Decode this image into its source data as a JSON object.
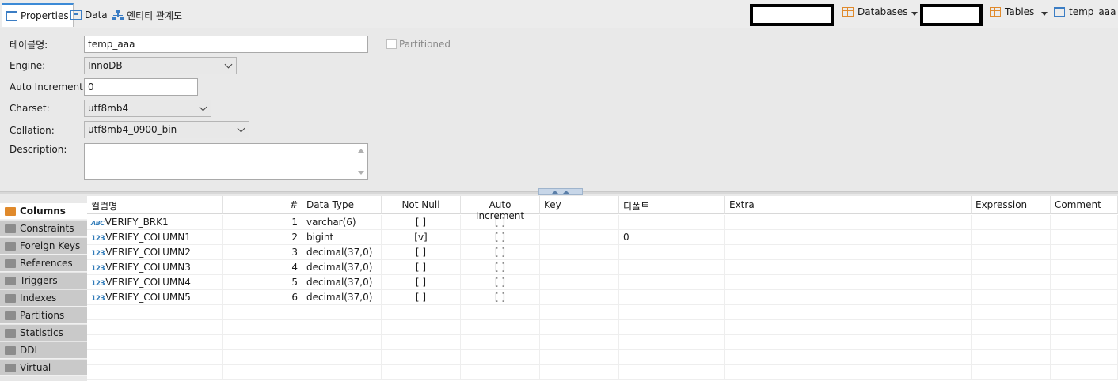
{
  "tabs": [
    {
      "label": "Properties",
      "icon": "properties-icon"
    },
    {
      "label": "Data",
      "icon": "data-grid-icon"
    },
    {
      "label": "엔티티 관계도",
      "icon": "er-diagram-icon"
    }
  ],
  "breadcrumb": {
    "databases": "Databases",
    "tables": "Tables",
    "table": "temp_aaa"
  },
  "properties": {
    "table_name_label": "테이블명:",
    "table_name": "temp_aaa",
    "partitioned_label": "Partitioned",
    "engine_label": "Engine:",
    "engine": "InnoDB",
    "auto_increment_label": "Auto Increment:",
    "auto_increment": "0",
    "charset_label": "Charset:",
    "charset": "utf8mb4",
    "collation_label": "Collation:",
    "collation": "utf8mb4_0900_bin",
    "description_label": "Description:",
    "description": ""
  },
  "side_tabs": [
    {
      "label": "Columns",
      "active": true
    },
    {
      "label": "Constraints"
    },
    {
      "label": "Foreign Keys"
    },
    {
      "label": "References"
    },
    {
      "label": "Triggers"
    },
    {
      "label": "Indexes"
    },
    {
      "label": "Partitions"
    },
    {
      "label": "Statistics"
    },
    {
      "label": "DDL"
    },
    {
      "label": "Virtual"
    }
  ],
  "grid": {
    "headers": [
      "컬럼명",
      "#",
      "Data Type",
      "Not Null",
      "Auto Increment",
      "Key",
      "디폴트",
      "Extra",
      "Expression",
      "Comment"
    ],
    "rows": [
      {
        "type_icon": "ABC",
        "name": "VERIFY_BRK1",
        "num": "1",
        "data_type": "varchar(6)",
        "not_null": "[ ]",
        "auto_inc": "[ ]",
        "key": "",
        "default": "",
        "extra": "",
        "expression": "",
        "comment": ""
      },
      {
        "type_icon": "123",
        "name": "VERIFY_COLUMN1",
        "num": "2",
        "data_type": "bigint",
        "not_null": "[v]",
        "auto_inc": "[ ]",
        "key": "",
        "default": "0",
        "extra": "",
        "expression": "",
        "comment": ""
      },
      {
        "type_icon": "123",
        "name": "VERIFY_COLUMN2",
        "num": "3",
        "data_type": "decimal(37,0)",
        "not_null": "[ ]",
        "auto_inc": "[ ]",
        "key": "",
        "default": "",
        "extra": "",
        "expression": "",
        "comment": ""
      },
      {
        "type_icon": "123",
        "name": "VERIFY_COLUMN3",
        "num": "4",
        "data_type": "decimal(37,0)",
        "not_null": "[ ]",
        "auto_inc": "[ ]",
        "key": "",
        "default": "",
        "extra": "",
        "expression": "",
        "comment": ""
      },
      {
        "type_icon": "123",
        "name": "VERIFY_COLUMN4",
        "num": "5",
        "data_type": "decimal(37,0)",
        "not_null": "[ ]",
        "auto_inc": "[ ]",
        "key": "",
        "default": "",
        "extra": "",
        "expression": "",
        "comment": ""
      },
      {
        "type_icon": "123",
        "name": "VERIFY_COLUMN5",
        "num": "6",
        "data_type": "decimal(37,0)",
        "not_null": "[ ]",
        "auto_inc": "[ ]",
        "key": "",
        "default": "",
        "extra": "",
        "expression": "",
        "comment": ""
      }
    ]
  },
  "colors": {
    "accent": "#3c8ad6",
    "folder": "#e08a2c",
    "type_icon": "#2f7ab8"
  }
}
